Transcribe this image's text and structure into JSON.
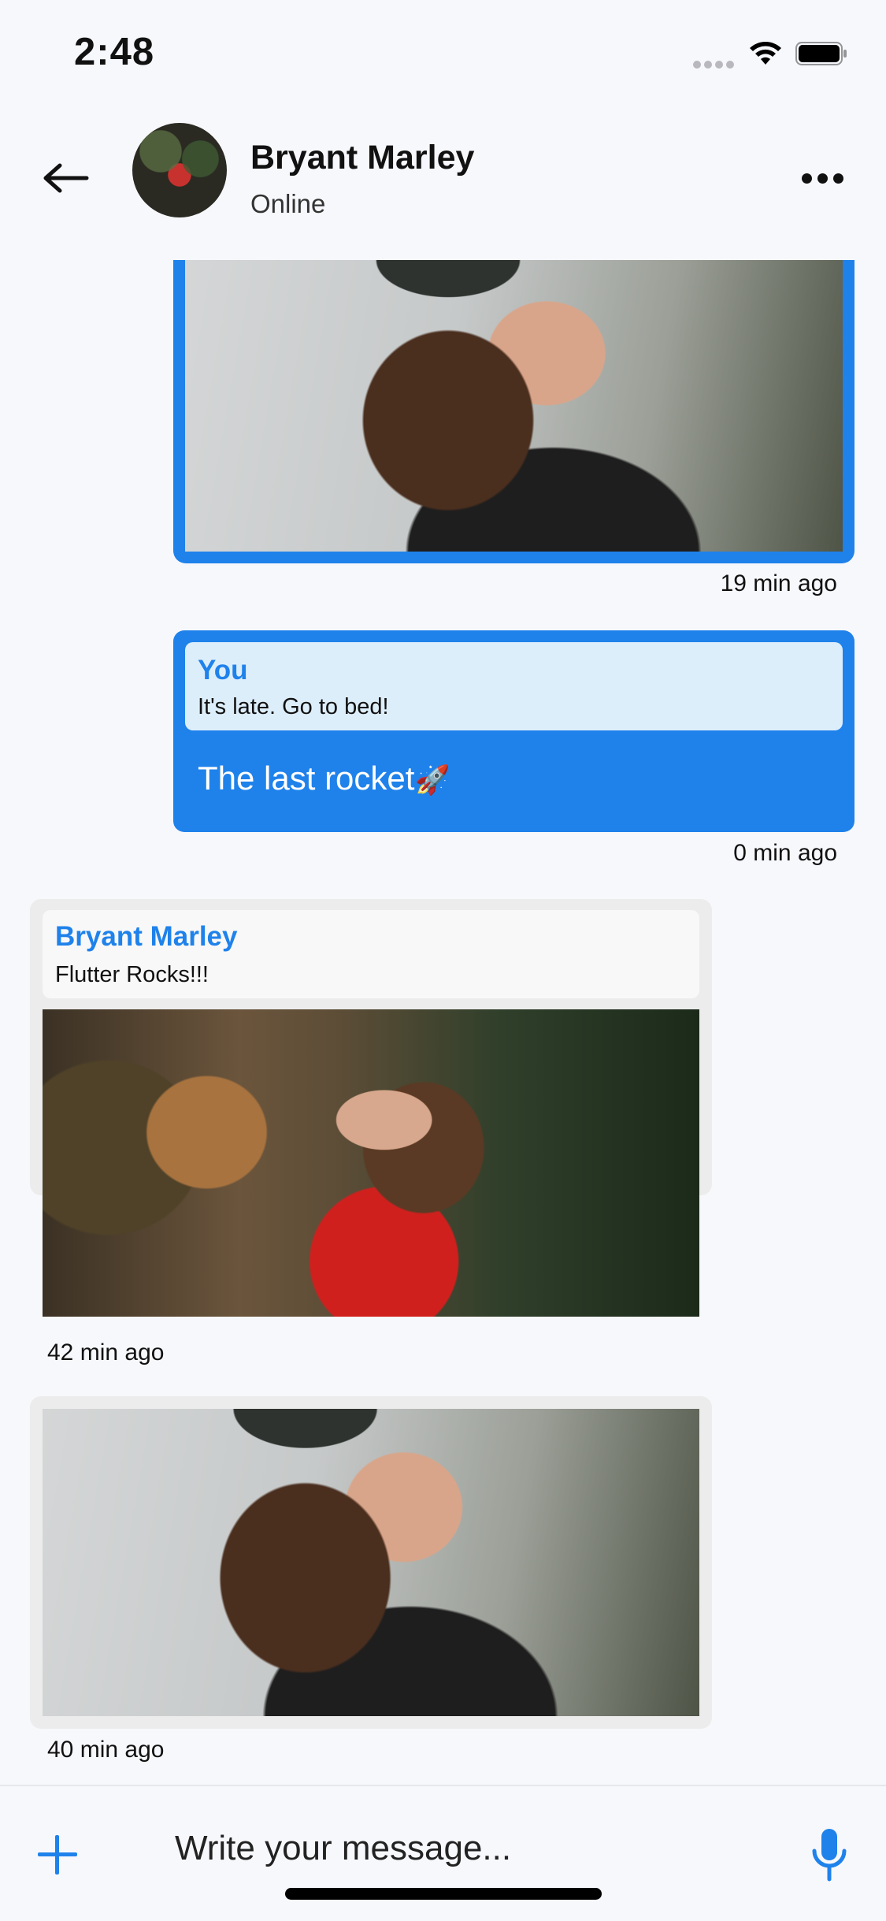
{
  "status_bar": {
    "time": "2:48"
  },
  "header": {
    "contact_name": "Bryant Marley",
    "contact_status": "Online"
  },
  "messages": [
    {
      "type": "image",
      "direction": "outgoing",
      "time": "19 min ago"
    },
    {
      "type": "reply",
      "direction": "outgoing",
      "reply_author": "You",
      "reply_text": "It's late. Go to bed!",
      "text": "The last rocket",
      "emoji": "🚀",
      "time": "0 min ago"
    },
    {
      "type": "image-reply",
      "direction": "incoming",
      "reply_author": "Bryant Marley",
      "reply_text": "Flutter Rocks!!!",
      "time": "42 min ago"
    },
    {
      "type": "image",
      "direction": "incoming",
      "time": "40 min ago"
    }
  ],
  "input": {
    "placeholder": "Write your message..."
  },
  "icons": {
    "back": "arrow-left-icon",
    "more": "more-horizontal-icon",
    "add": "plus-icon",
    "mic": "microphone-icon"
  },
  "colors": {
    "accent": "#1F82EB",
    "incoming_bubble": "#ECECEC",
    "reply_out_bg": "#DDEEFB",
    "background": "#F7F8FC"
  }
}
